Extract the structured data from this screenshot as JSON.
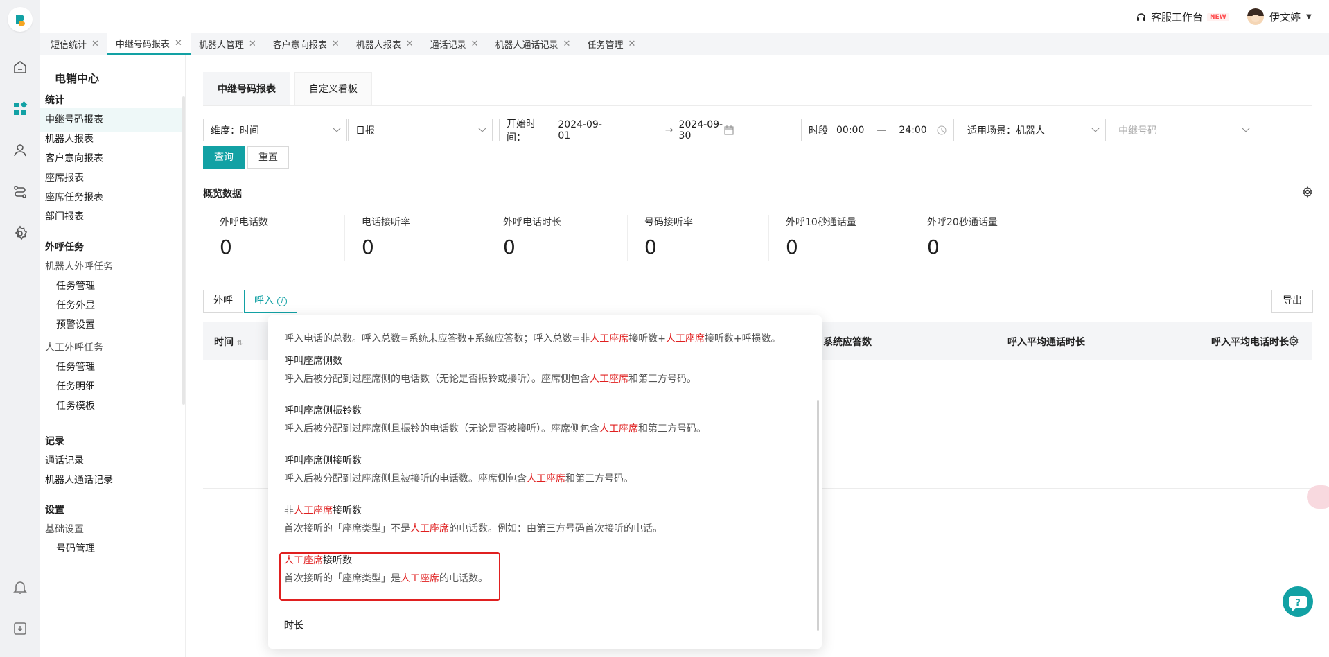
{
  "topbar": {
    "workspace_label": "客服工作台",
    "new_badge": "NEW",
    "user_name": "伊文婷"
  },
  "tabs": [
    {
      "label": "短信统计"
    },
    {
      "label": "中继号码报表"
    },
    {
      "label": "机器人管理"
    },
    {
      "label": "客户意向报表"
    },
    {
      "label": "机器人报表"
    },
    {
      "label": "通话记录"
    },
    {
      "label": "机器人通话记录"
    },
    {
      "label": "任务管理"
    }
  ],
  "menu": {
    "title": "电销中心",
    "items": [
      "统计",
      "中继号码报表",
      "机器人报表",
      "客户意向报表",
      "座席报表",
      "座席任务报表",
      "部门报表",
      "外呼任务",
      "机器人外呼任务",
      "任务管理",
      "任务外显",
      "预警设置",
      "人工外呼任务",
      "任务管理",
      "任务明细",
      "任务模板",
      "记录",
      "通话记录",
      "机器人通话记录",
      "设置",
      "基础设置",
      "号码管理"
    ]
  },
  "page_tabs": [
    "中继号码报表",
    "自定义看板"
  ],
  "filters": {
    "dimension": "维度：时间",
    "period": "日报",
    "start_label": "开始时间：",
    "start_date": "2024-09-01",
    "arrow": "→",
    "end_date": "2024-09-30",
    "time_label": "时段",
    "time_start": "00:00",
    "time_dash": "—",
    "time_end": "24:00",
    "scene": "适用场景：机器人",
    "number_placeholder": "中继号码",
    "query": "查询",
    "reset": "重置"
  },
  "overview": {
    "title": "概览数据",
    "kpis": [
      {
        "label": "外呼电话数",
        "value": "0"
      },
      {
        "label": "电话接听率",
        "value": "0"
      },
      {
        "label": "外呼电话时长",
        "value": "0"
      },
      {
        "label": "号码接听率",
        "value": "0"
      },
      {
        "label": "外呼10秒通话量",
        "value": "0"
      },
      {
        "label": "外呼20秒通话量",
        "value": "0"
      }
    ]
  },
  "segment": {
    "outbound": "外呼",
    "inbound": "呼入",
    "export": "导出"
  },
  "table": {
    "headers": [
      "时间",
      "系统应答数",
      "呼入平均通话时长",
      "呼入平均电话时长"
    ]
  },
  "popup": {
    "top_desc": [
      "呼入电话的总数。呼入总数=系统未应答数+系统应答数；呼入总数=非",
      "人工座席",
      "接听数+",
      "人工座席",
      "接听数+呼损数。"
    ],
    "sections": [
      {
        "title": "呼叫座席侧数",
        "desc": [
          "呼入后被分配到过座席侧的电话数（无论是否振铃或接听）。座席侧包含",
          "人工座席",
          "和第三方号码。"
        ]
      },
      {
        "title": "呼叫座席侧振铃数",
        "desc": [
          "呼入后被分配到过座席侧且振铃的电话数（无论是否被接听）。座席侧包含",
          "人工座席",
          "和第三方号码。"
        ]
      },
      {
        "title": "呼叫座席侧接听数",
        "desc": [
          "呼入后被分配到过座席侧且被接听的电话数。座席侧包含",
          "人工座席",
          "和第三方号码。"
        ]
      },
      {
        "title": [
          "非",
          "人工座席",
          "接听数"
        ],
        "desc": [
          "首次接听的「座席类型」不是",
          "人工座席",
          "的电话数。例如：由第三方号码首次接听的电话。"
        ]
      },
      {
        "title": [
          "人工座席",
          "接听数"
        ],
        "desc": [
          "首次接听的「座席类型」是",
          "人工座席",
          "的电话数。"
        ]
      }
    ],
    "last_title": "时长"
  },
  "colors": {
    "accent": "#12a1a4",
    "highlight": "#e02020"
  }
}
